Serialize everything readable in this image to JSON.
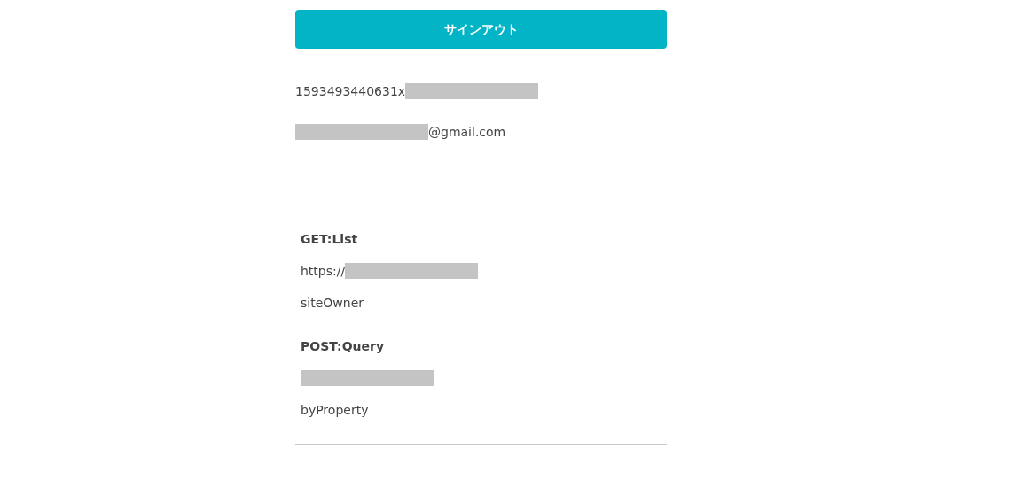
{
  "signout_button": {
    "label": "サインアウト"
  },
  "account_lines": [
    {
      "segments": [
        {
          "kind": "text",
          "text": "1593493440631x"
        },
        {
          "kind": "redacted"
        }
      ]
    },
    {
      "segments": [
        {
          "kind": "redacted"
        },
        {
          "kind": "text",
          "text": "@gmail.com"
        }
      ]
    }
  ],
  "endpoints": [
    {
      "title": "GET:List",
      "lines": [
        {
          "segments": [
            {
              "kind": "text",
              "text": "https://"
            },
            {
              "kind": "redacted"
            }
          ]
        },
        {
          "segments": [
            {
              "kind": "text",
              "text": "siteOwner"
            }
          ]
        }
      ]
    },
    {
      "title": "POST:Query",
      "lines": [
        {
          "segments": [
            {
              "kind": "redacted"
            }
          ]
        },
        {
          "segments": [
            {
              "kind": "text",
              "text": "byProperty"
            }
          ]
        }
      ]
    }
  ]
}
